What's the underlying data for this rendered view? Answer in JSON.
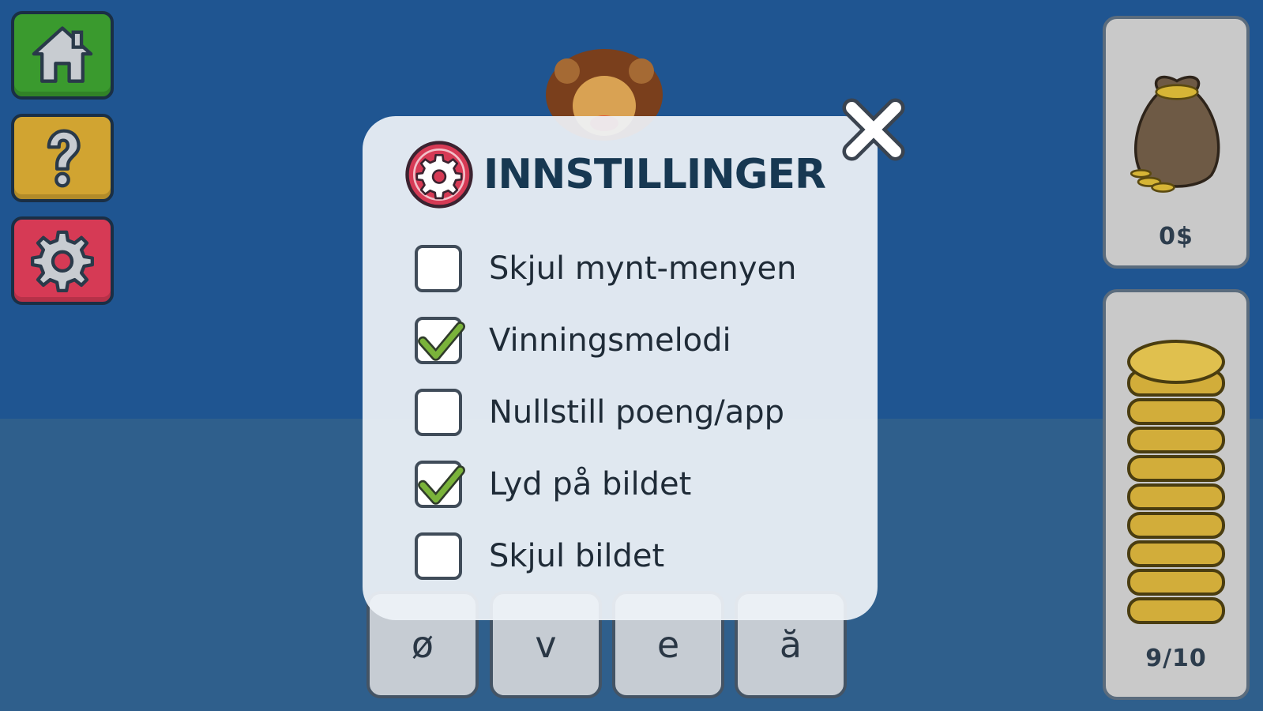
{
  "sidebar": {
    "items": [
      {
        "name": "home",
        "icon": "home-icon",
        "color": "#3a9a2e"
      },
      {
        "name": "help",
        "icon": "question-mark-icon",
        "color": "#d1a431"
      },
      {
        "name": "settings",
        "icon": "gear-icon",
        "color": "#d63a55"
      }
    ]
  },
  "coins": {
    "balance": "0$",
    "bag_icon": "money-bag-icon"
  },
  "progress": {
    "label": "9/10",
    "stack_icon": "coin-stack-icon"
  },
  "tiles": {
    "row3": [
      "ø",
      "v",
      "e",
      "ă"
    ]
  },
  "dialog": {
    "title": "INNSTILLINGER",
    "title_icon": "gear-icon",
    "close_icon": "close-icon",
    "options": [
      {
        "label": "Skjul mynt-menyen",
        "checked": false
      },
      {
        "label": "Vinningsmelodi",
        "checked": true
      },
      {
        "label": "Nullstill poeng/app",
        "checked": false
      },
      {
        "label": "Lyd på bildet",
        "checked": true
      },
      {
        "label": "Skjul bildet",
        "checked": false
      }
    ]
  },
  "colors": {
    "sky": "#1f5591",
    "floor": "#2f5f8c",
    "accent": "#d63a55",
    "check": "#7ab33a",
    "title": "#173852"
  }
}
